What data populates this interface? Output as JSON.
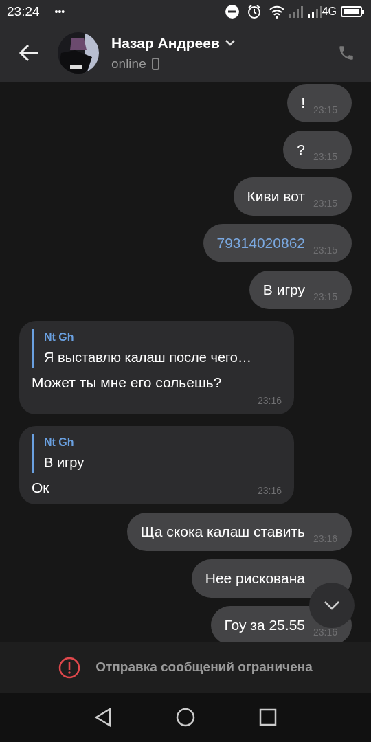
{
  "status_bar": {
    "time": "23:24",
    "more": "•••",
    "network": "4G"
  },
  "header": {
    "name": "Назар Андреев",
    "status": "online"
  },
  "messages": [
    {
      "kind": "outgoing",
      "text": "!",
      "time": "23:15"
    },
    {
      "kind": "outgoing",
      "text": "?",
      "time": "23:15"
    },
    {
      "kind": "outgoing",
      "text": "Киви вот",
      "time": "23:15"
    },
    {
      "kind": "outgoing",
      "text": "79314020862",
      "time": "23:15",
      "link": true
    },
    {
      "kind": "outgoing",
      "text": "В игру",
      "time": "23:15"
    },
    {
      "kind": "incoming",
      "reply_author": "Nt Gh",
      "reply_text": "Я выставлю калаш после чего…",
      "text": "Может ты мне его сольешь?",
      "time": "23:16"
    },
    {
      "kind": "incoming",
      "reply_author": "Nt Gh",
      "reply_text": "В игру",
      "text": "Ок",
      "time": "23:16"
    },
    {
      "kind": "outgoing",
      "text": "Ща скока калаш ставить",
      "time": "23:16"
    },
    {
      "kind": "outgoing",
      "text": "Нее рискована"
    },
    {
      "kind": "outgoing",
      "text": "Гоу за 25.55",
      "time": "23:16"
    }
  ],
  "footer": {
    "notice": "Отправка сообщений ограничена"
  }
}
